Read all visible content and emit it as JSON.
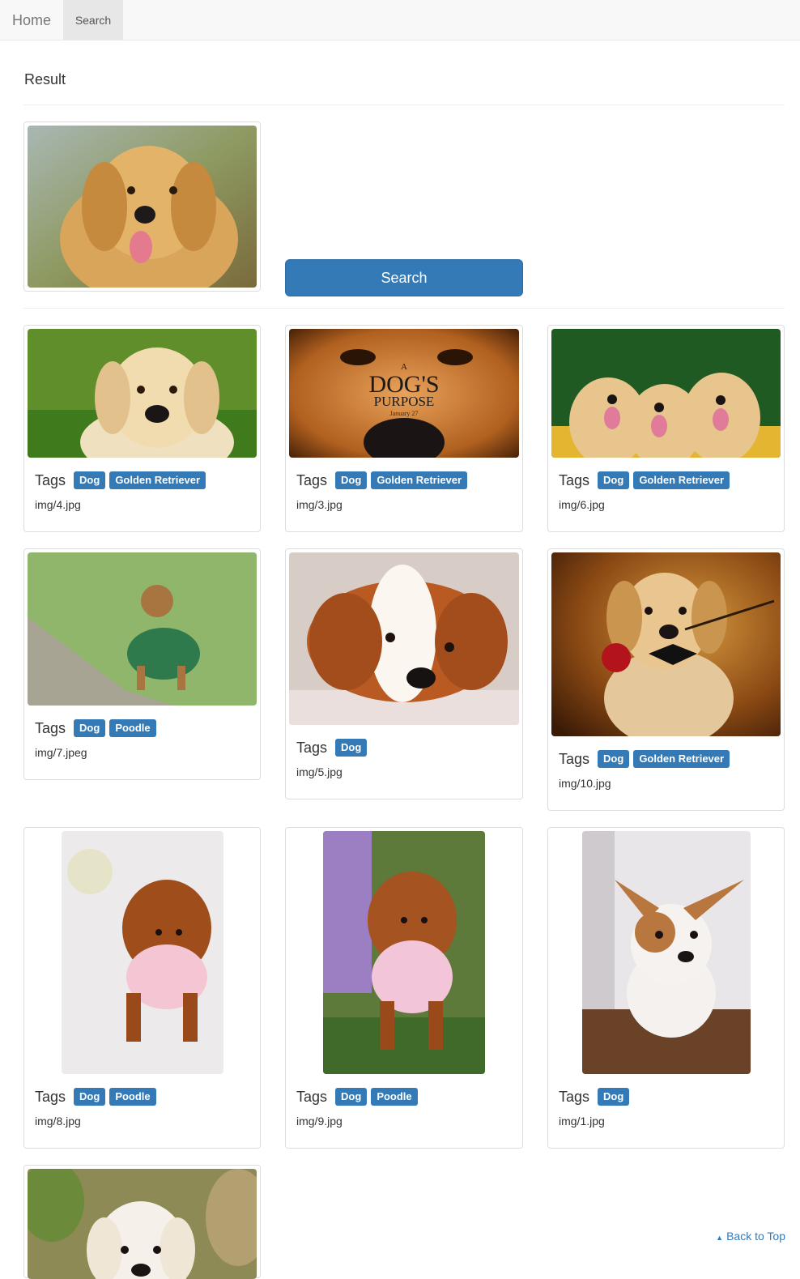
{
  "nav": {
    "brand": "Home",
    "active": "Search"
  },
  "page": {
    "title": "Result"
  },
  "search": {
    "button": "Search"
  },
  "tags_label": "Tags",
  "results": [
    {
      "file": "img/4.jpg",
      "tags": [
        "Dog",
        "Golden Retriever"
      ]
    },
    {
      "file": "img/3.jpg",
      "tags": [
        "Dog",
        "Golden Retriever"
      ]
    },
    {
      "file": "img/6.jpg",
      "tags": [
        "Dog",
        "Golden Retriever"
      ]
    },
    {
      "file": "img/7.jpeg",
      "tags": [
        "Dog",
        "Poodle"
      ]
    },
    {
      "file": "img/5.jpg",
      "tags": [
        "Dog"
      ]
    },
    {
      "file": "img/10.jpg",
      "tags": [
        "Dog",
        "Golden Retriever"
      ]
    },
    {
      "file": "img/8.jpg",
      "tags": [
        "Dog",
        "Poodle"
      ]
    },
    {
      "file": "img/9.jpg",
      "tags": [
        "Dog",
        "Poodle"
      ]
    },
    {
      "file": "img/1.jpg",
      "tags": [
        "Dog"
      ]
    }
  ],
  "poster": {
    "line1": "A",
    "line2": "DOG'S",
    "line3": "PURPOSE",
    "line4": "January 27"
  },
  "back_to_top": "Back to Top",
  "colors": {
    "primary": "#337ab7",
    "navbar": "#f8f8f8"
  }
}
